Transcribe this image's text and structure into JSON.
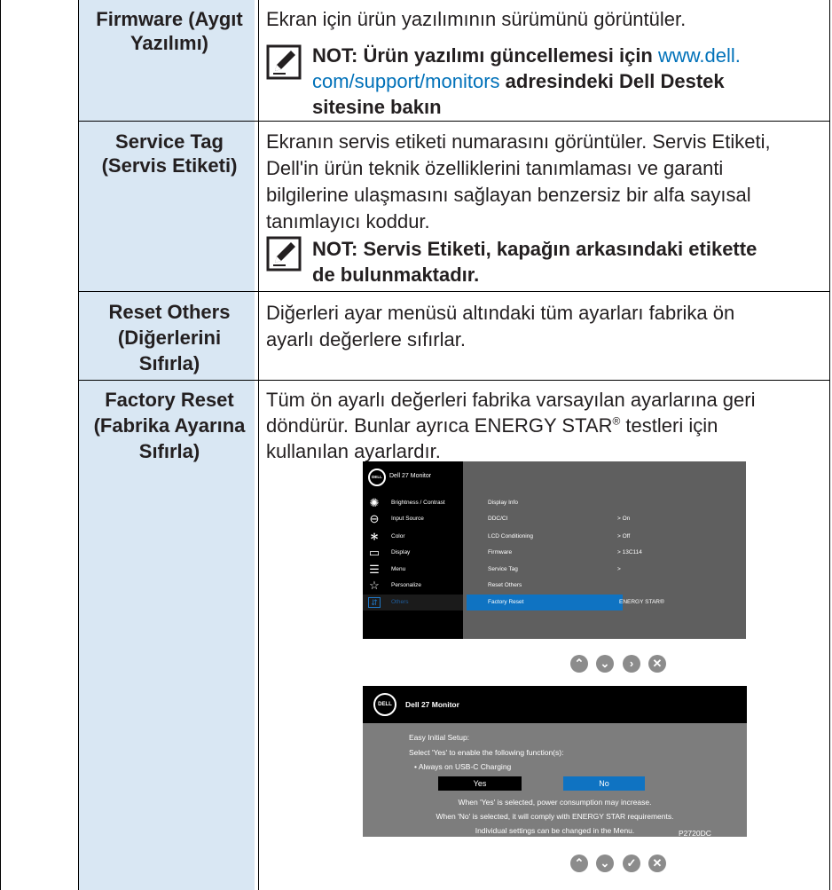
{
  "rows": [
    {
      "setting": [
        "Firmware (Aygıt",
        "Yazılımı)"
      ],
      "description": "Ekran için ürün yazılımının sürümünü görüntüler.",
      "note_bold_prefix": "NOT: Ürün yazılımı güncellemesi için ",
      "note_link": [
        "www.dell.",
        "com/support/monitors"
      ],
      "note_bold_suffix": [
        " adresindeki Dell Destek",
        "sitesine bakın"
      ]
    },
    {
      "setting": [
        "Service Tag",
        "(Servis Etiketi)"
      ],
      "description": [
        "Ekranın servis etiketi numarasını görüntüler. Servis Etiketi,",
        "Dell'in ürün teknik özelliklerini tanımlaması ve garanti",
        "bilgilerine ulaşmasını sağlayan benzersiz bir alfa sayısal",
        "tanımlayıcı koddur."
      ],
      "note": [
        "NOT: Servis Etiketi, kapağın arkasındaki etikette",
        "de bulunmaktadır."
      ]
    },
    {
      "setting": [
        "Reset Others",
        "(Diğerlerini",
        "Sıfırla)"
      ],
      "description": [
        "Diğerleri ayar menüsü altındaki tüm ayarları fabrika ön",
        "ayarlı değerlere sıfırlar."
      ]
    },
    {
      "setting": [
        "Factory Reset",
        "(Fabrika Ayarına",
        "Sıfırla)"
      ],
      "description_line1": "Tüm ön ayarlı değerleri fabrika varsayılan ayarlarına geri",
      "description_line2_pre": "döndürür. Bunlar ayrıca ENERGY STAR",
      "description_sup": "®",
      "description_line2_post": " testleri için",
      "description_line3": "kullanılan ayarlardır."
    }
  ],
  "osd_menu": {
    "logo": "DELL",
    "title": "Dell 27 Monitor",
    "menu_items": [
      {
        "label": "Brightness / Contrast",
        "icon": "sun-icon"
      },
      {
        "label": "Input Source",
        "icon": "input-source-icon"
      },
      {
        "label": "Color",
        "icon": "color-icon"
      },
      {
        "label": "Display",
        "icon": "display-icon"
      },
      {
        "label": "Menu",
        "icon": "menu-icon"
      },
      {
        "label": "Personalize",
        "icon": "star-icon"
      },
      {
        "label": "Others",
        "icon": "others-icon"
      }
    ],
    "sub_items": [
      {
        "label": "Display Info",
        "value": ""
      },
      {
        "label": "DDC/CI",
        "value": ">  On"
      },
      {
        "label": "LCD Conditioning",
        "value": ">  Off"
      },
      {
        "label": "Firmware",
        "value": ">  13C114"
      },
      {
        "label": "Service Tag",
        "value": ">"
      },
      {
        "label": "Reset Others",
        "value": ""
      },
      {
        "label": "Factory Reset",
        "value": "ENERGY STAR®"
      }
    ]
  },
  "osd_buttons_1": [
    "up",
    "down",
    "right",
    "close"
  ],
  "osd_dialog": {
    "logo": "DELL",
    "title": "Dell 27 Monitor",
    "line1": "Easy Initial Setup:",
    "line2": "Select 'Yes' to enable the following function(s):",
    "line3": "• Always on USB-C Charging",
    "yes": "Yes",
    "no": "No",
    "info1": "When 'Yes' is selected, power consumption may increase.",
    "info2": "When 'No' is selected, it will comply with ENERGY STAR requirements.",
    "info3": "Individual settings can be changed in the Menu.",
    "model": "P2720DC"
  },
  "osd_buttons_2": [
    "up",
    "down",
    "check",
    "close"
  ],
  "colors": {
    "header_bg": "#d9e7f3",
    "link": "#0071b9",
    "osd_highlight": "#0f73c2"
  }
}
